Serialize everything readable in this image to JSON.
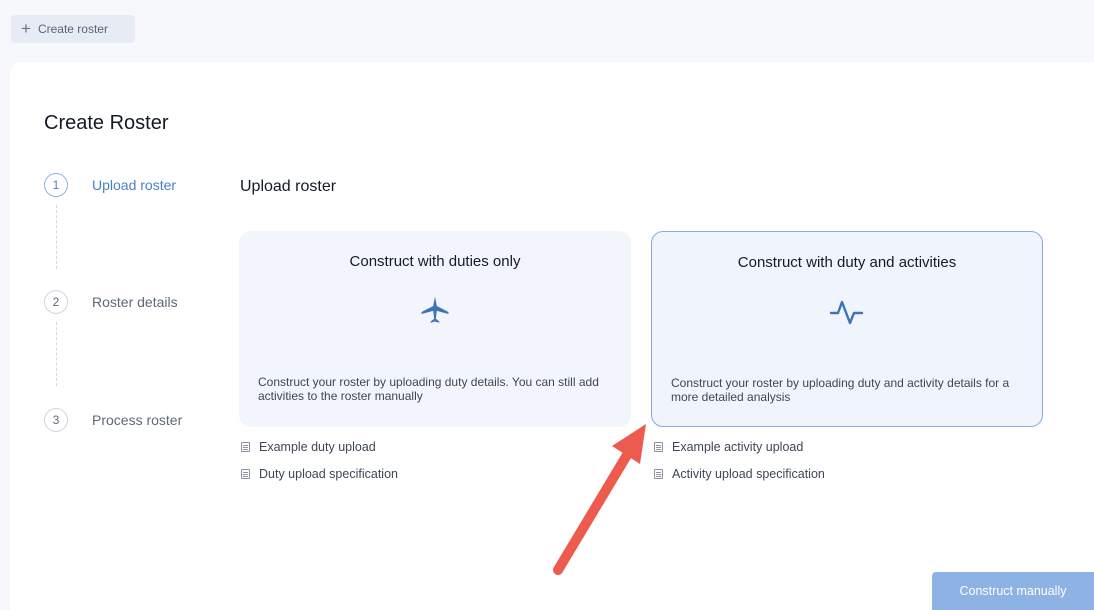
{
  "topbar": {
    "create_label": "Create roster"
  },
  "panel": {
    "title": "Create Roster"
  },
  "steps": [
    {
      "number": "1",
      "label": "Upload roster"
    },
    {
      "number": "2",
      "label": "Roster details"
    },
    {
      "number": "3",
      "label": "Process roster"
    }
  ],
  "section": {
    "title": "Upload roster"
  },
  "cards": [
    {
      "title": "Construct with duties only",
      "icon": "airplane-icon",
      "description": "Construct your roster by uploading duty details. You can still add activities to the roster manually",
      "links": [
        "Example duty upload",
        "Duty upload specification"
      ]
    },
    {
      "title": "Construct with duty and activities",
      "icon": "activity-pulse-icon",
      "description": "Construct your roster by uploading duty and activity details for a more detailed analysis",
      "links": [
        "Example activity upload",
        "Activity upload specification"
      ]
    }
  ],
  "footer": {
    "construct_manually_label": "Construct manually"
  },
  "colors": {
    "accent": "#4a7fc8",
    "button": "#8db2e4",
    "arrow": "#ec5b4d"
  }
}
